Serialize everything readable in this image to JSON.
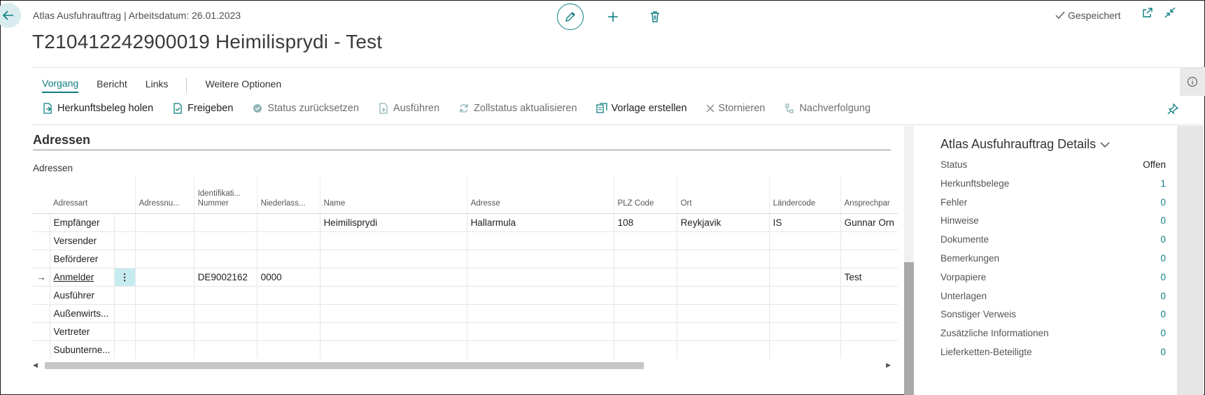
{
  "header": {
    "caption": "Atlas Ausfuhrauftrag | Arbeitsdatum: 26.01.2023",
    "title": "T210412242900019 Heimilisprydi - Test",
    "saved_label": "Gespeichert"
  },
  "tabs": [
    {
      "label": "Vorgang"
    },
    {
      "label": "Bericht"
    },
    {
      "label": "Links"
    },
    {
      "label": "Weitere Optionen"
    }
  ],
  "actions": [
    {
      "label": "Herkunftsbeleg holen",
      "icon": "fetch-document-icon"
    },
    {
      "label": "Freigeben",
      "icon": "release-icon"
    },
    {
      "label": "Status zurücksetzen",
      "icon": "reset-status-icon"
    },
    {
      "label": "Ausführen",
      "icon": "execute-icon"
    },
    {
      "label": "Zollstatus aktualisieren",
      "icon": "refresh-icon"
    },
    {
      "label": "Vorlage erstellen",
      "icon": "template-icon"
    },
    {
      "label": "Stornieren",
      "icon": "cancel-icon"
    },
    {
      "label": "Nachverfolgung",
      "icon": "tracking-icon"
    }
  ],
  "section": {
    "title": "Adressen",
    "subtitle": "Adressen"
  },
  "grid": {
    "columns": [
      {
        "label": "Adressart"
      },
      {
        "label": "Adressnu..."
      },
      {
        "label": "Identifikati... Nummer"
      },
      {
        "label": "Niederlass..."
      },
      {
        "label": "Name"
      },
      {
        "label": "Adresse"
      },
      {
        "label": "PLZ Code"
      },
      {
        "label": "Ort"
      },
      {
        "label": "Ländercode"
      },
      {
        "label": "Ansprechpar"
      }
    ],
    "rows": [
      {
        "type": "Empfänger",
        "nr": "",
        "ident": "",
        "branch": "",
        "name": "Heimilisprydi",
        "address": "Hallarmula",
        "zip": "108",
        "city": "Reykjavik",
        "country": "IS",
        "contact": "Gunnar Orn"
      },
      {
        "type": "Versender",
        "nr": "",
        "ident": "",
        "branch": "",
        "name": "",
        "address": "",
        "zip": "",
        "city": "",
        "country": "",
        "contact": ""
      },
      {
        "type": "Beförderer",
        "nr": "",
        "ident": "",
        "branch": "",
        "name": "",
        "address": "",
        "zip": "",
        "city": "",
        "country": "",
        "contact": ""
      },
      {
        "type": "Anmelder",
        "nr": "",
        "ident": "DE9002162",
        "branch": "0000",
        "name": "",
        "address": "",
        "zip": "",
        "city": "",
        "country": "",
        "contact": "Test",
        "selected": true
      },
      {
        "type": "Ausführer",
        "nr": "",
        "ident": "",
        "branch": "",
        "name": "",
        "address": "",
        "zip": "",
        "city": "",
        "country": "",
        "contact": ""
      },
      {
        "type": "Außenwirts...",
        "nr": "",
        "ident": "",
        "branch": "",
        "name": "",
        "address": "",
        "zip": "",
        "city": "",
        "country": "",
        "contact": ""
      },
      {
        "type": "Vertreter",
        "nr": "",
        "ident": "",
        "branch": "",
        "name": "",
        "address": "",
        "zip": "",
        "city": "",
        "country": "",
        "contact": ""
      },
      {
        "type": "Subunterne...",
        "nr": "",
        "ident": "",
        "branch": "",
        "name": "",
        "address": "",
        "zip": "",
        "city": "",
        "country": "",
        "contact": ""
      }
    ],
    "selected_marker": "→",
    "row_menu": "⋮"
  },
  "factbox": {
    "title": "Atlas Ausfuhrauftrag Details",
    "rows": [
      {
        "label": "Status",
        "value": "Offen"
      },
      {
        "label": "Herkunftsbelege",
        "value": "1"
      },
      {
        "label": "Fehler",
        "value": "0"
      },
      {
        "label": "Hinweise",
        "value": "0"
      },
      {
        "label": "Dokumente",
        "value": "0"
      },
      {
        "label": "Bemerkungen",
        "value": "0"
      },
      {
        "label": "Vorpapiere",
        "value": "0"
      },
      {
        "label": "Unterlagen",
        "value": "0"
      },
      {
        "label": "Sonstiger Verweis",
        "value": "0"
      },
      {
        "label": "Zusätzliche Informationen",
        "value": "0"
      },
      {
        "label": "Lieferketten-Beteiligte",
        "value": "0"
      }
    ]
  },
  "colors": {
    "accent": "#0f7e83",
    "selected_cell": "#c7ecef",
    "back_button": "#d9ecef"
  }
}
